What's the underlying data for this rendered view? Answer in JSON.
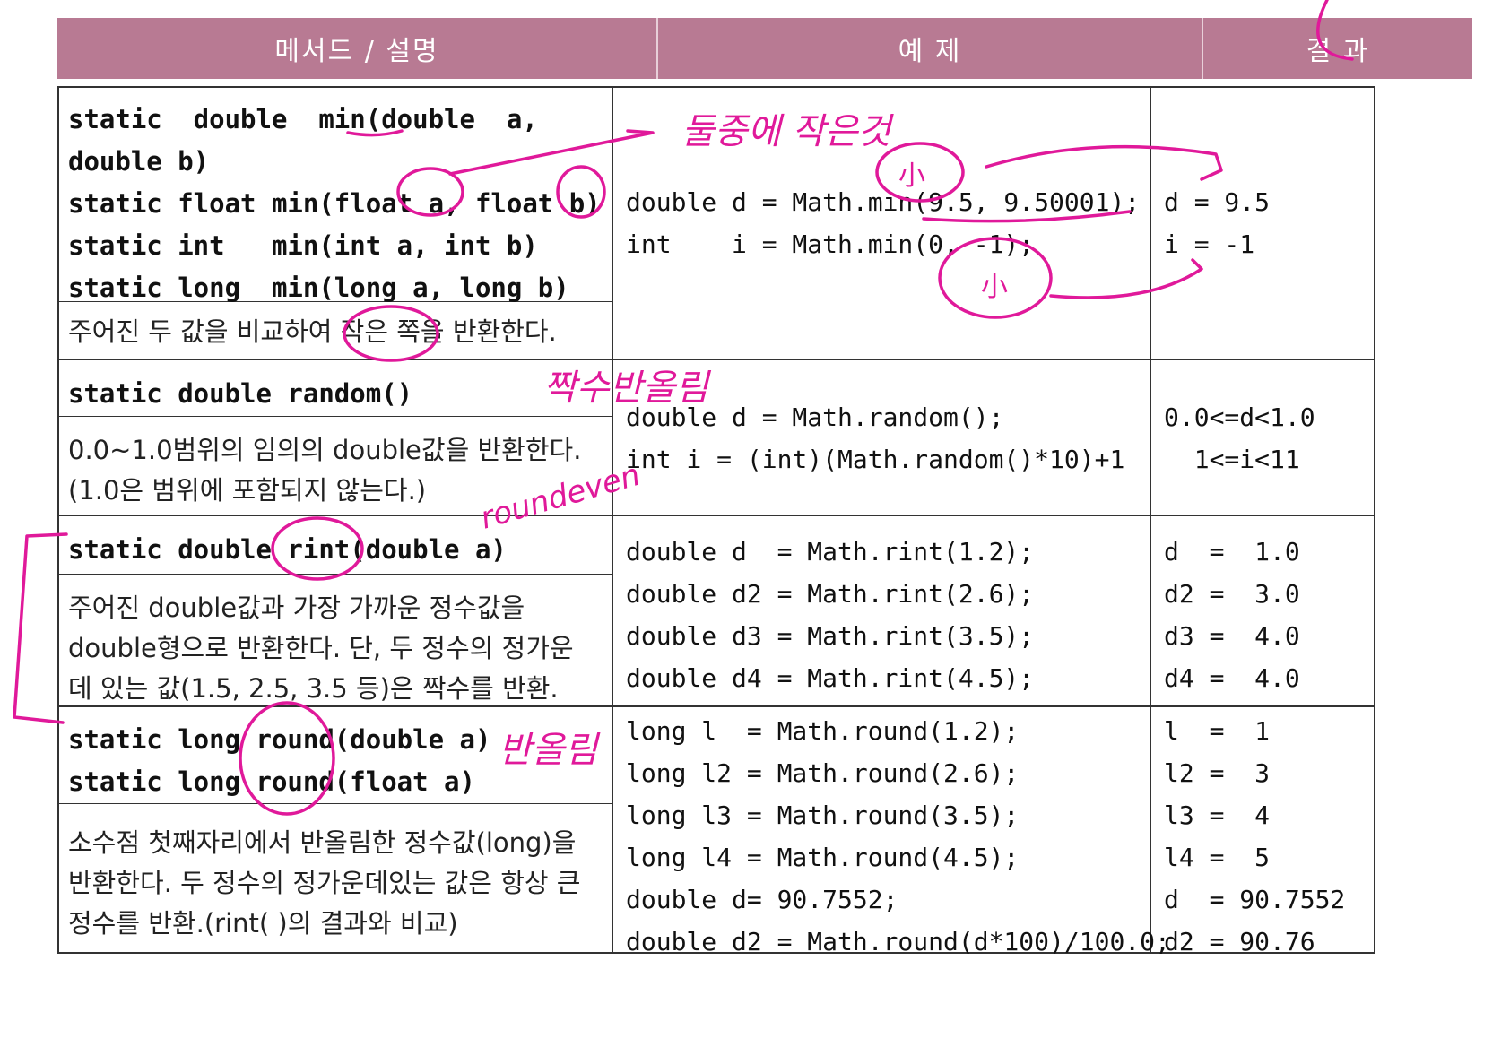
{
  "header": {
    "col1": "메서드 / 설명",
    "col2": "예 제",
    "col3": "결 과"
  },
  "rows": [
    {
      "signature": "static  double  min(double  a,\ndouble b)\nstatic float min(float a, float b)\nstatic int   min(int a, int b)\nstatic long  min(long a, long b)",
      "description": "주어진 두 값을 비교하여 작은 쪽을 반환한다.",
      "example": "double d = Math.min(9.5, 9.50001);\nint    i = Math.min(0, -1);",
      "result": "d = 9.5\ni = -1"
    },
    {
      "signature": "static double random()",
      "description": "0.0~1.0범위의 임의의 double값을 반환한다. (1.0은 범위에 포함되지 않는다.)",
      "example": "double d = Math.random();\nint i = (int)(Math.random()*10)+1",
      "result": "0.0<=d<1.0\n  1<=i<11"
    },
    {
      "signature": "static double rint(double a)",
      "description": "주어진 double값과 가장 가까운 정수값을 double형으로 반환한다. 단, 두 정수의 정가운데 있는 값(1.5, 2.5, 3.5 등)은 짝수를 반환.",
      "example": "double d  = Math.rint(1.2);\ndouble d2 = Math.rint(2.6);\ndouble d3 = Math.rint(3.5);\ndouble d4 = Math.rint(4.5);",
      "result": "d  =  1.0\nd2 =  3.0\nd3 =  4.0\nd4 =  4.0"
    },
    {
      "signature": "static long round(double a)\nstatic long round(float a)",
      "description": "소수점 첫째자리에서 반올림한 정수값(long)을 반환한다. 두 정수의 정가운데있는 값은 항상 큰 정수를 반환.(rint( )의 결과와 비교)",
      "example": "long l  = Math.round(1.2);\nlong l2 = Math.round(2.6);\nlong l3 = Math.round(3.5);\nlong l4 = Math.round(4.5);\ndouble d= 90.7552;\ndouble d2 = Math.round(d*100)/100.0;",
      "result": "l  =  1\nl2 =  3\nl3 =  4\nl4 =  5\nd  = 90.7552\nd2 = 90.76"
    }
  ],
  "annotations": {
    "min_note": "둘중에 작은것",
    "small_1": "小",
    "small_2": "小",
    "random_note": "짝수반올림",
    "rint_note": "roundeven",
    "round_note": "반올림"
  },
  "colors": {
    "header_bg": "#b87a93",
    "ink": "#e0199a",
    "grid": "#333333"
  }
}
